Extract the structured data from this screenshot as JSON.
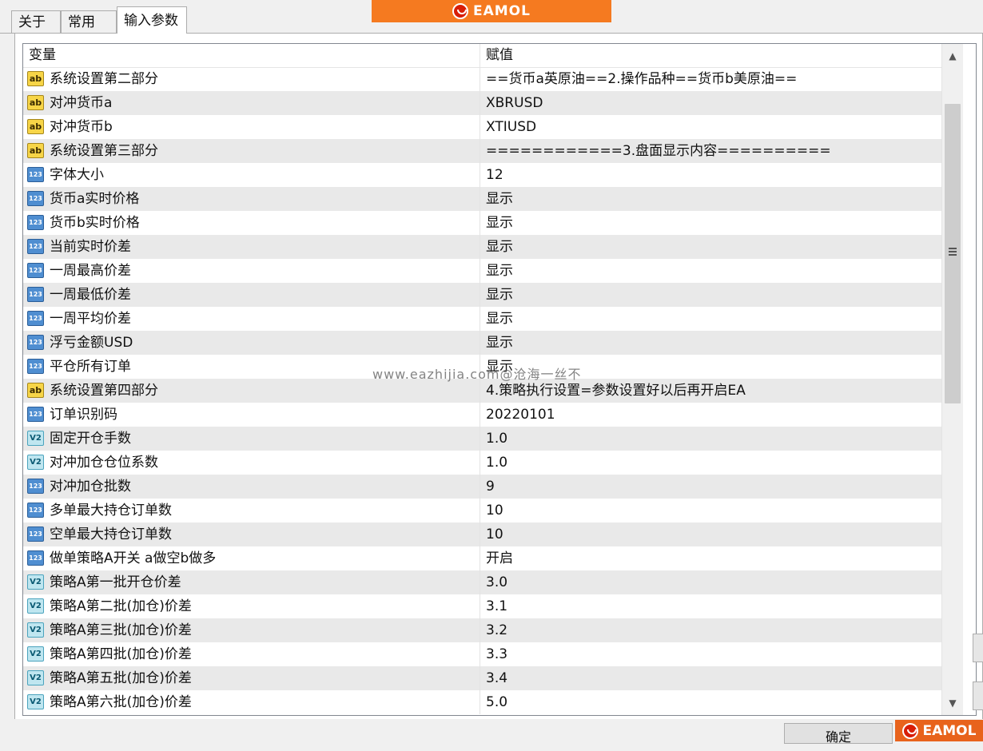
{
  "tabs": [
    {
      "label": "关于"
    },
    {
      "label": "常用"
    },
    {
      "label": "输入参数"
    }
  ],
  "brand": {
    "name": "EAMOL",
    "color": "#f57a20",
    "icon": "eamol-logo-icon"
  },
  "table": {
    "headers": {
      "variable": "变量",
      "value": "赋值"
    },
    "rows": [
      {
        "type": "str",
        "icon": "ab",
        "name": "系统设置第二部分",
        "value": "==货币a英原油==2.操作品种==货币b美原油=="
      },
      {
        "type": "str",
        "icon": "ab",
        "name": "对冲货币a",
        "value": "XBRUSD"
      },
      {
        "type": "str",
        "icon": "ab",
        "name": "对冲货币b",
        "value": "XTIUSD"
      },
      {
        "type": "str",
        "icon": "ab",
        "name": "系统设置第三部分",
        "value": "============3.盘面显示内容=========="
      },
      {
        "type": "int",
        "icon": "123",
        "name": "字体大小",
        "value": "12"
      },
      {
        "type": "int",
        "icon": "123",
        "name": "货币a实时价格",
        "value": "显示"
      },
      {
        "type": "int",
        "icon": "123",
        "name": "货币b实时价格",
        "value": "显示"
      },
      {
        "type": "int",
        "icon": "123",
        "name": "当前实时价差",
        "value": "显示"
      },
      {
        "type": "int",
        "icon": "123",
        "name": "一周最高价差",
        "value": "显示"
      },
      {
        "type": "int",
        "icon": "123",
        "name": "一周最低价差",
        "value": "显示"
      },
      {
        "type": "int",
        "icon": "123",
        "name": "一周平均价差",
        "value": "显示"
      },
      {
        "type": "int",
        "icon": "123",
        "name": "浮亏金额USD",
        "value": "显示"
      },
      {
        "type": "int",
        "icon": "123",
        "name": "平仓所有订单",
        "value": "显示"
      },
      {
        "type": "str",
        "icon": "ab",
        "name": "系统设置第四部分",
        "value": "4.策略执行设置=参数设置好以后再开启EA"
      },
      {
        "type": "int",
        "icon": "123",
        "name": "订单识别码",
        "value": "20220101"
      },
      {
        "type": "dbl",
        "icon": "V2",
        "name": "固定开仓手数",
        "value": "1.0"
      },
      {
        "type": "dbl",
        "icon": "V2",
        "name": "对冲加仓仓位系数",
        "value": "1.0"
      },
      {
        "type": "int",
        "icon": "123",
        "name": "对冲加仓批数",
        "value": "9"
      },
      {
        "type": "int",
        "icon": "123",
        "name": "多单最大持仓订单数",
        "value": "10"
      },
      {
        "type": "int",
        "icon": "123",
        "name": "空单最大持仓订单数",
        "value": "10"
      },
      {
        "type": "int",
        "icon": "123",
        "name": "做单策略A开关  a做空b做多",
        "value": "开启"
      },
      {
        "type": "dbl",
        "icon": "V2",
        "name": "策略A第一批开仓价差",
        "value": "3.0"
      },
      {
        "type": "dbl",
        "icon": "V2",
        "name": "策略A第二批(加仓)价差",
        "value": "3.1"
      },
      {
        "type": "dbl",
        "icon": "V2",
        "name": "策略A第三批(加仓)价差",
        "value": "3.2"
      },
      {
        "type": "dbl",
        "icon": "V2",
        "name": "策略A第四批(加仓)价差",
        "value": "3.3"
      },
      {
        "type": "dbl",
        "icon": "V2",
        "name": "策略A第五批(加仓)价差",
        "value": "3.4"
      },
      {
        "type": "dbl",
        "icon": "V2",
        "name": "策略A第六批(加仓)价差",
        "value": "5.0"
      }
    ]
  },
  "watermark": "www.eazhijia.com@沧海一丝不",
  "buttons": {
    "ok": "确定"
  }
}
